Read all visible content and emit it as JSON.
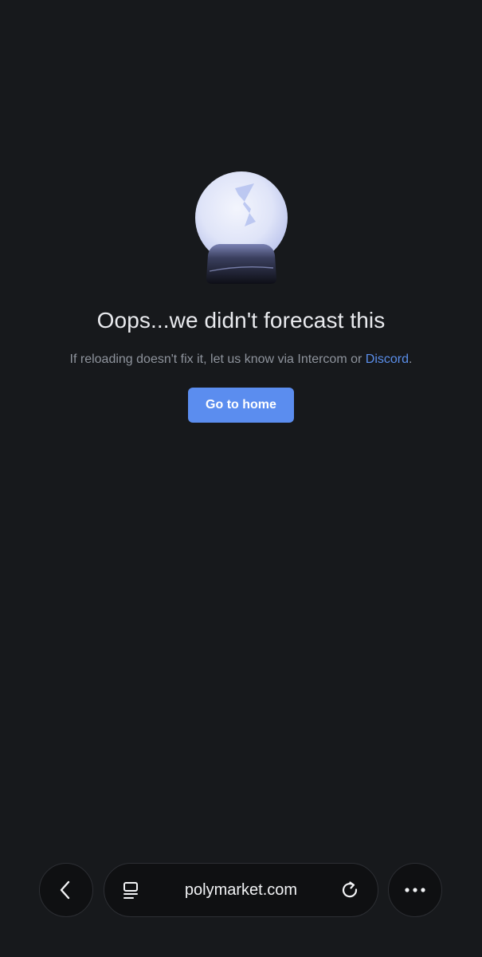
{
  "error": {
    "icon": "crystal-ball-icon",
    "title": "Oops...we didn't forecast this",
    "subtitle_prefix": "If reloading doesn't fix it, let us know via Intercom or ",
    "subtitle_link": "Discord",
    "subtitle_suffix": ".",
    "button_label": "Go to home",
    "accent_color": "#5b8def"
  },
  "browser": {
    "url": "polymarket.com",
    "back_icon": "chevron-left-icon",
    "page_icon": "page-layout-icon",
    "reload_icon": "reload-icon",
    "more_icon": "more-dots-icon"
  }
}
